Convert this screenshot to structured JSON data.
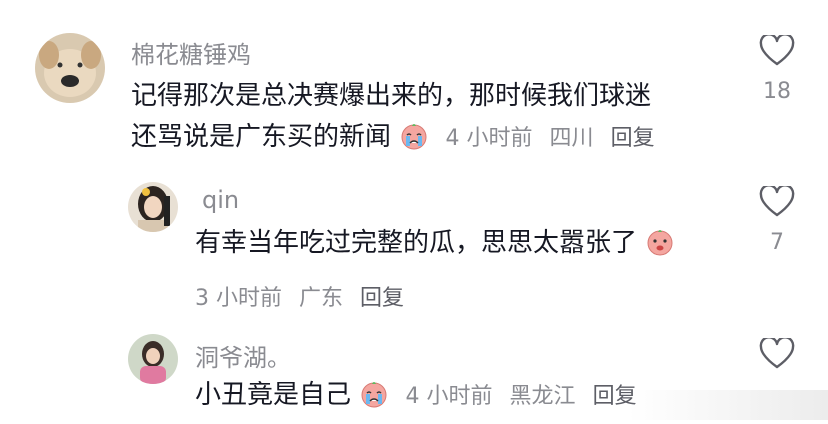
{
  "comments": [
    {
      "username": "棉花糖锤鸡",
      "text_line1": "记得那次是总决赛爆出来的，那时候我们球迷",
      "text_line2": "还骂说是广东买的新闻",
      "time": "4 小时前",
      "location": "四川",
      "reply_label": "回复",
      "likes": "18"
    },
    {
      "username": "qin",
      "text": "有幸当年吃过完整的瓜，思思太嚣张了",
      "time": "3 小时前",
      "location": "广东",
      "reply_label": "回复",
      "likes": "7"
    },
    {
      "username": "洞爷湖。",
      "text": "小丑竟是自己",
      "time": "4 小时前",
      "location": "黑龙江",
      "reply_label": "回复"
    }
  ],
  "colors": {
    "text": "#161823",
    "secondary": "#8a8b91",
    "reply": "#5d5e66",
    "emoji": "#f4a6a0"
  }
}
